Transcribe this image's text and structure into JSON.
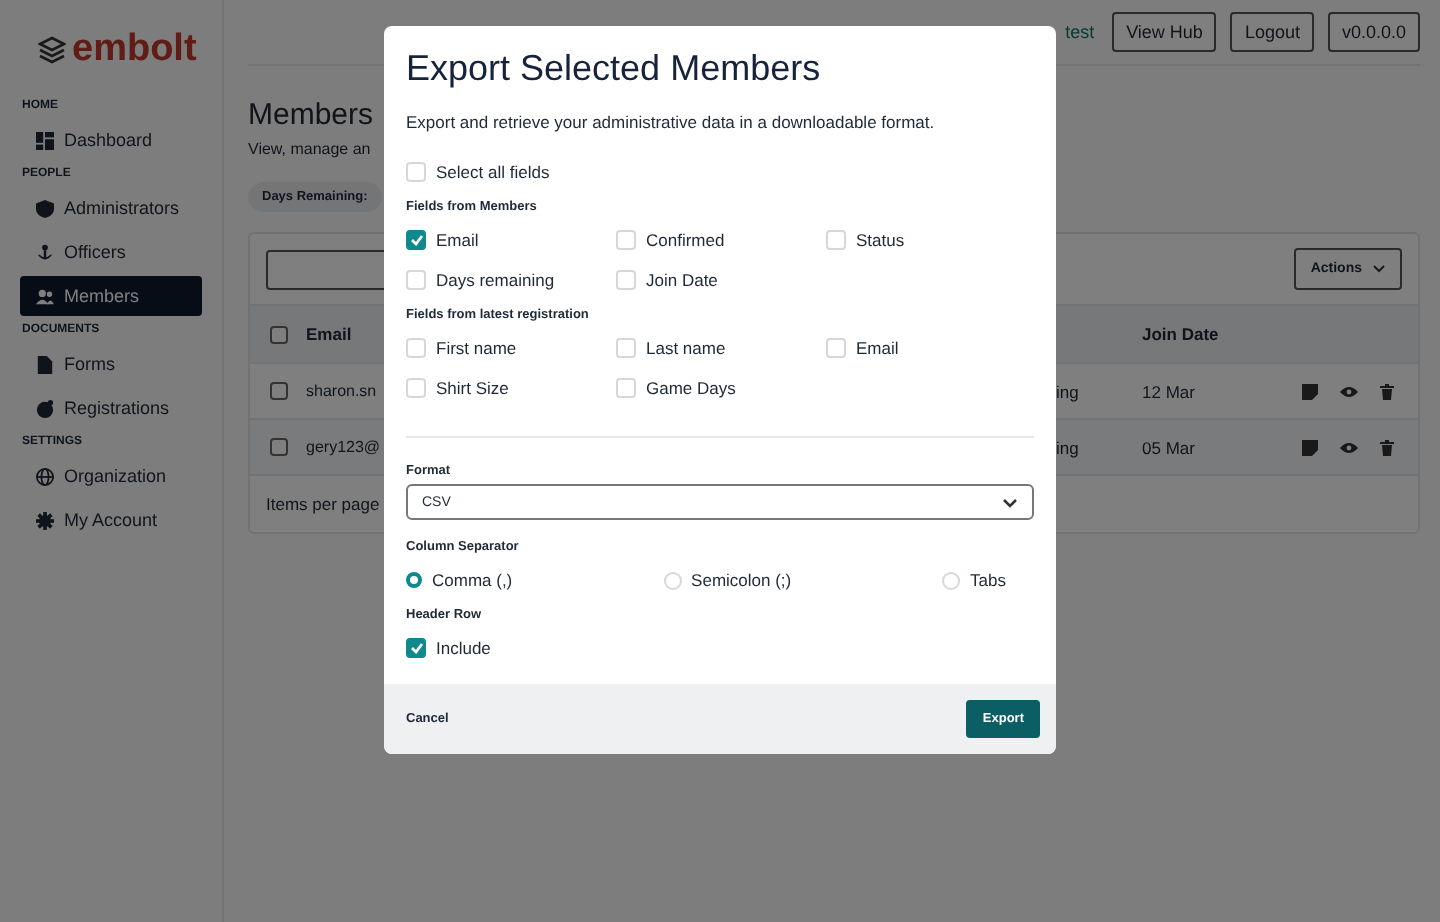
{
  "sidebar": {
    "logo": "embolt",
    "sections": [
      {
        "heading": "HOME",
        "items": [
          {
            "label": "Dashboard",
            "selected": false
          }
        ]
      },
      {
        "heading": "PEOPLE",
        "items": [
          {
            "label": "Administrators",
            "selected": false
          },
          {
            "label": "Officers",
            "selected": false
          },
          {
            "label": "Members",
            "selected": true
          }
        ]
      },
      {
        "heading": "DOCUMENTS",
        "items": [
          {
            "label": "Forms",
            "selected": false
          },
          {
            "label": "Registrations",
            "selected": false
          }
        ]
      },
      {
        "heading": "SETTINGS",
        "items": [
          {
            "label": "Organization",
            "selected": false
          },
          {
            "label": "My Account",
            "selected": false
          }
        ]
      }
    ]
  },
  "topbar": {
    "user": "test",
    "buttons": [
      "View Hub",
      "Logout",
      "v0.0.0.0"
    ]
  },
  "page": {
    "title": "Members",
    "subtitle": "View, manage an",
    "filter_chip": "Days Remaining:",
    "actions_button": "Actions",
    "table": {
      "header": {
        "email": "Email",
        "join_date": "Join Date",
        "selected": false
      },
      "rows": [
        {
          "email": "sharon.sn",
          "column_3": "ing",
          "join_date": "12 Mar",
          "selected": false
        },
        {
          "email": "gery123@",
          "column_3": "ing",
          "join_date": "05 Mar",
          "selected": false
        }
      ],
      "footer": "Items per page"
    }
  },
  "modal": {
    "title": "Export Selected Members",
    "description": "Export and retrieve your administrative data in a downloadable format.",
    "select_all": {
      "label": "Select all fields",
      "checked": false
    },
    "groups": [
      {
        "heading": "Fields from Members",
        "fields": [
          {
            "label": "Email",
            "checked": true
          },
          {
            "label": "Confirmed",
            "checked": false
          },
          {
            "label": "Status",
            "checked": false
          },
          {
            "label": "Days remaining",
            "checked": false
          },
          {
            "label": "Join Date",
            "checked": false
          }
        ]
      },
      {
        "heading": "Fields from latest registration",
        "fields": [
          {
            "label": "First name",
            "checked": false
          },
          {
            "label": "Last name",
            "checked": false
          },
          {
            "label": "Email",
            "checked": false
          },
          {
            "label": "Shirt Size",
            "checked": false
          },
          {
            "label": "Game Days",
            "checked": false
          }
        ]
      }
    ],
    "format": {
      "label": "Format",
      "value": "CSV"
    },
    "separator": {
      "label": "Column Separator",
      "options": [
        {
          "label": "Comma (,)",
          "selected": true
        },
        {
          "label": "Semicolon (;)",
          "selected": false
        },
        {
          "label": "Tabs",
          "selected": false
        }
      ]
    },
    "header_row": {
      "label": "Header Row",
      "option": {
        "label": "Include",
        "checked": true
      }
    },
    "cancel": "Cancel",
    "export": "Export"
  }
}
